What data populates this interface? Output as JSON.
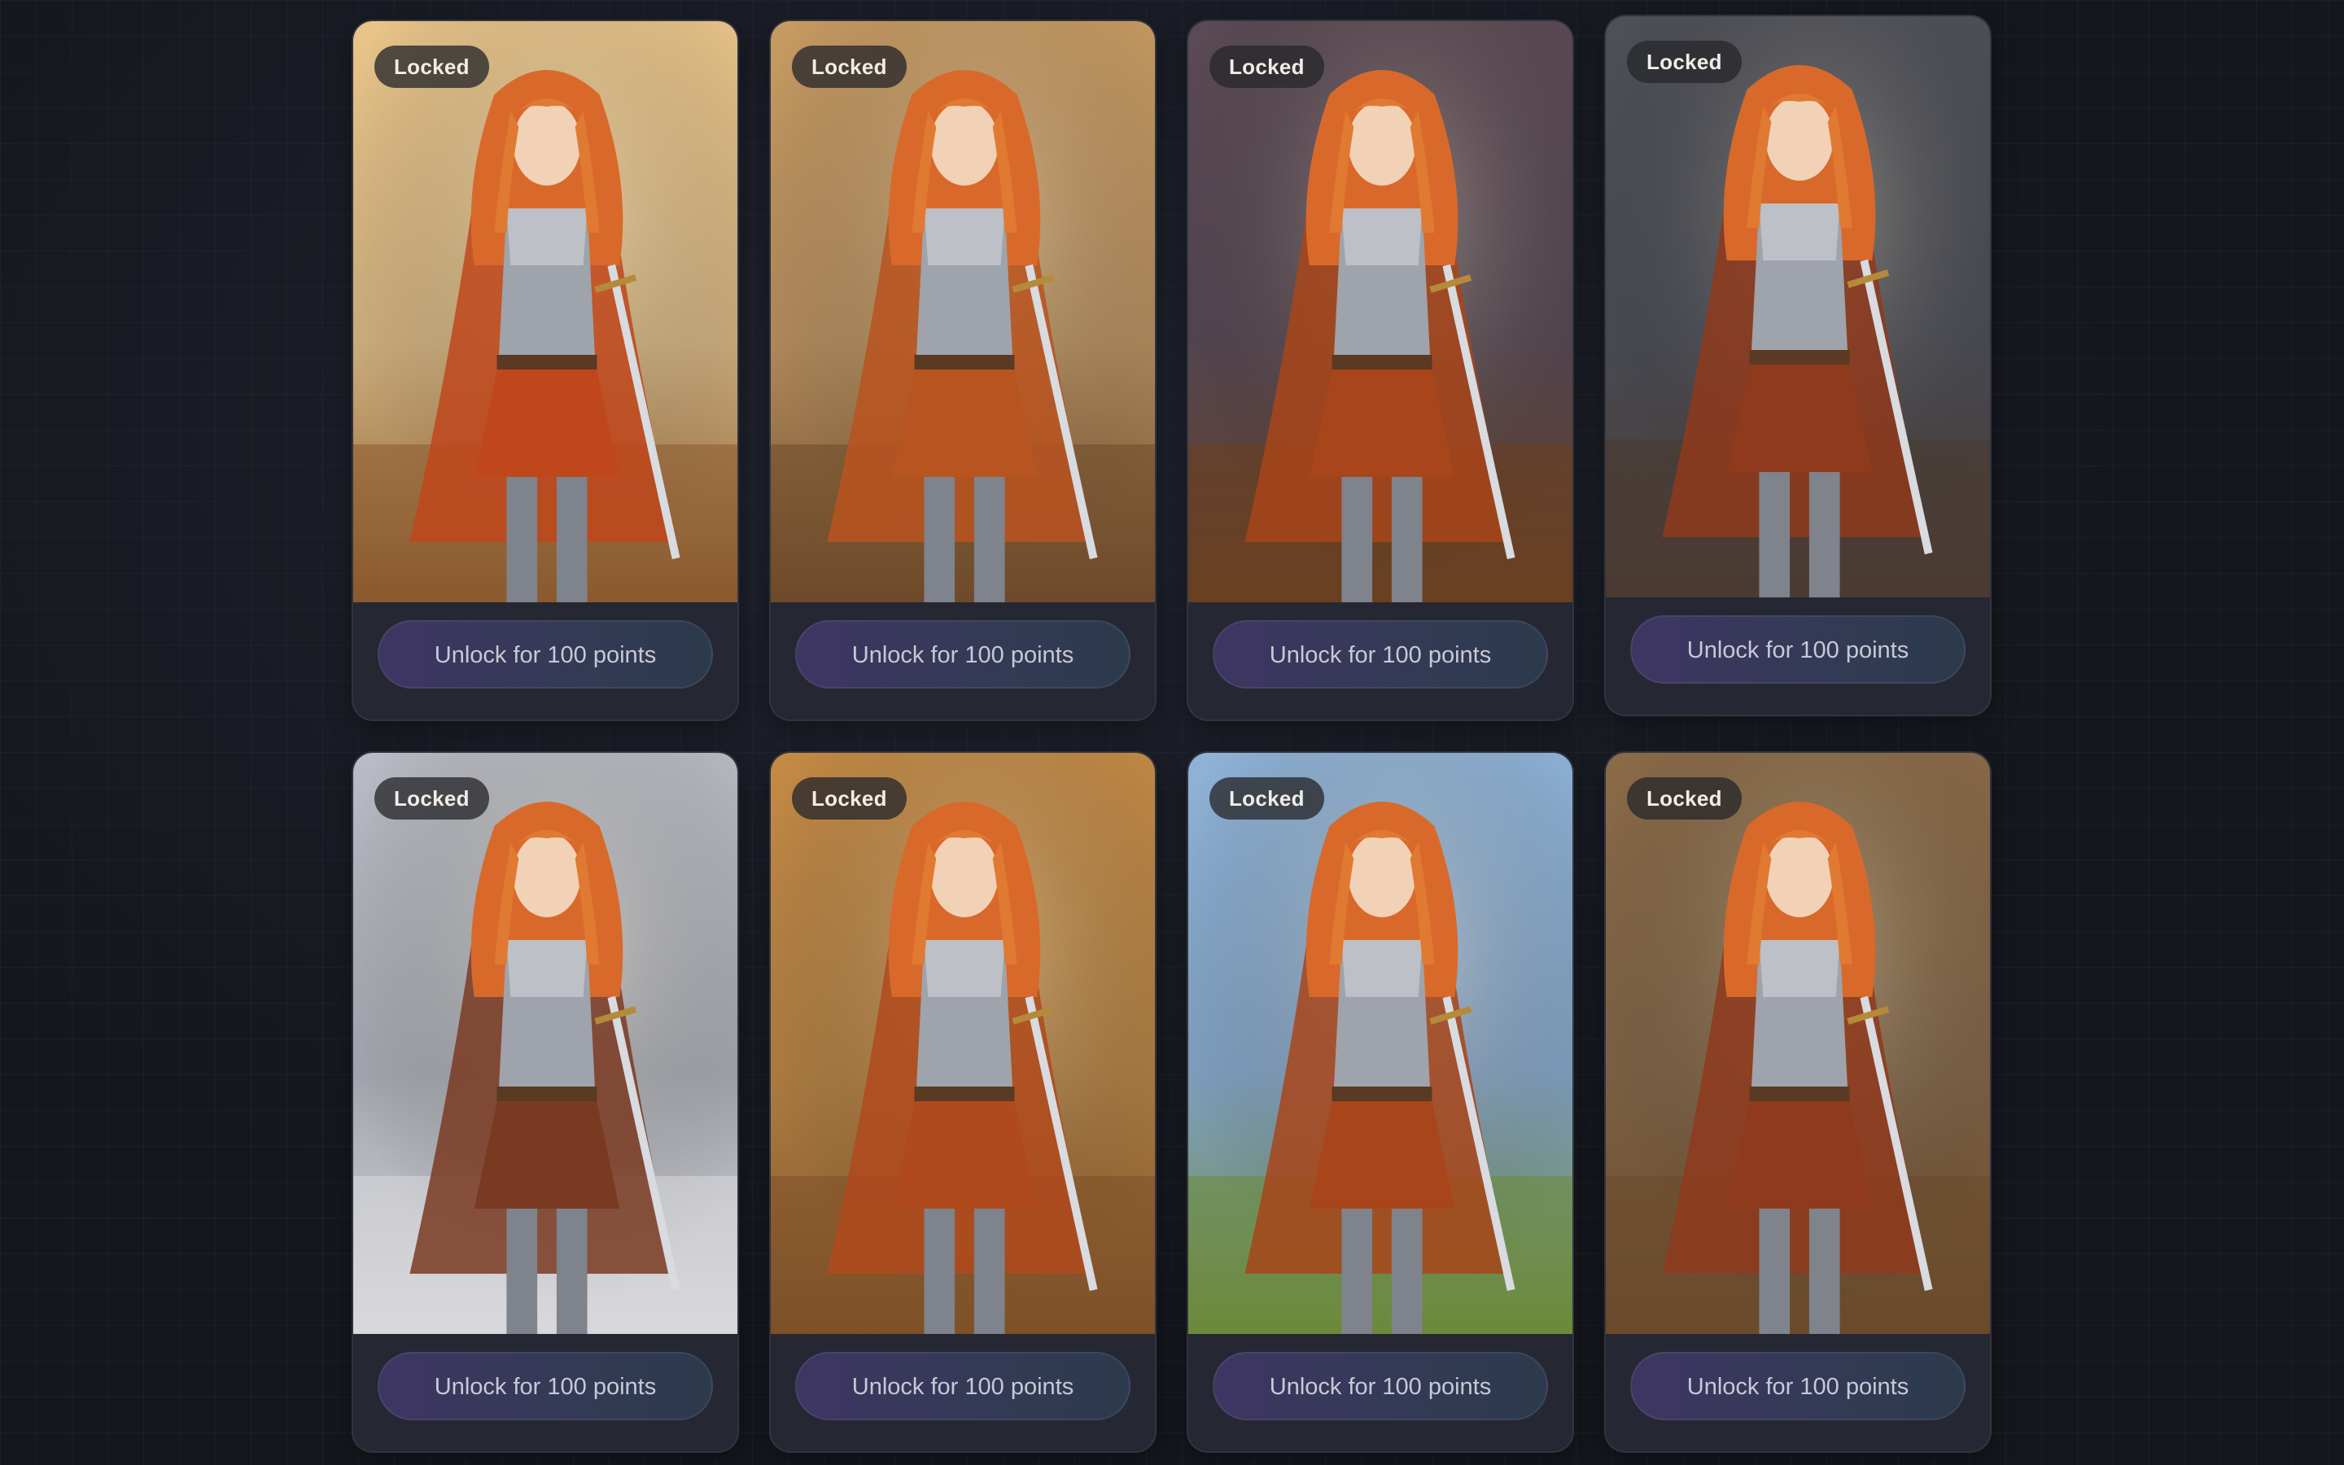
{
  "gallery": {
    "cards": [
      {
        "badge": "Locked",
        "button": "Unlock for 100 points",
        "theme": {
          "sky": "#e9c58a",
          "ground": "#8a5a2e",
          "accent": "#c0471b"
        }
      },
      {
        "badge": "Locked",
        "button": "Unlock for 100 points",
        "theme": {
          "sky": "#c79a62",
          "ground": "#6e4a2a",
          "accent": "#b8541f"
        }
      },
      {
        "badge": "Locked",
        "button": "Unlock for 100 points",
        "theme": {
          "sky": "#5b4a55",
          "ground": "#6a4020",
          "accent": "#a8451a"
        }
      },
      {
        "badge": "Locked",
        "button": "Unlock for 100 points",
        "theme": {
          "sky": "#4e5058",
          "ground": "#4a3a32",
          "accent": "#8f3a1c"
        }
      },
      {
        "badge": "Locked",
        "button": "Unlock for 100 points",
        "theme": {
          "sky": "#b9bcc4",
          "ground": "#d8d8dc",
          "accent": "#7a3a22"
        }
      },
      {
        "badge": "Locked",
        "button": "Unlock for 100 points",
        "theme": {
          "sky": "#c48a45",
          "ground": "#7d5128",
          "accent": "#b04a1c"
        }
      },
      {
        "badge": "Locked",
        "button": "Unlock for 100 points",
        "theme": {
          "sky": "#8fb3d8",
          "ground": "#6c8a3a",
          "accent": "#a8451a"
        }
      },
      {
        "badge": "Locked",
        "button": "Unlock for 100 points",
        "theme": {
          "sky": "#8a6a48",
          "ground": "#6a4a2c",
          "accent": "#8f3a1c"
        }
      }
    ]
  },
  "icons": {
    "artwork": "character-illustration"
  },
  "colors": {
    "background": "#15171e",
    "card": "#252832",
    "button_start": "#3e3563",
    "button_end": "#2c3a4d"
  }
}
